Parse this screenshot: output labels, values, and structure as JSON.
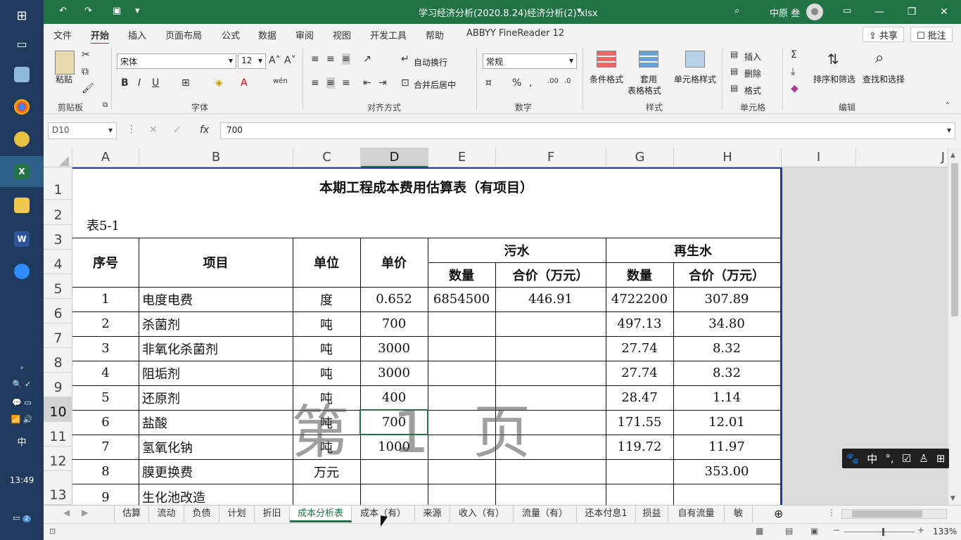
{
  "window": {
    "title": "学习经济分析(2020.8.24)经济分析(2).xlsx",
    "user": "中原 叁"
  },
  "menu": {
    "items": [
      "文件",
      "开始",
      "插入",
      "页面布局",
      "公式",
      "数据",
      "审阅",
      "视图",
      "开发工具",
      "帮助",
      "ABBYY FineReader 12"
    ],
    "share": "共享",
    "comment": "批注"
  },
  "ribbon": {
    "clipboard": {
      "paste": "粘贴",
      "label": "剪贴板"
    },
    "font": {
      "name": "宋体",
      "size": "12",
      "label": "字体",
      "bold": "B",
      "italic": "I",
      "underline": "U"
    },
    "alignment": {
      "wrap": "自动换行",
      "merge": "合并后居中",
      "label": "对齐方式"
    },
    "number": {
      "format": "常规",
      "label": "数字"
    },
    "styles": {
      "cond": "条件格式",
      "table1": "套用",
      "table2": "表格格式",
      "cell": "单元格样式",
      "label": "样式"
    },
    "cells": {
      "insert": "插入",
      "delete": "删除",
      "format": "格式",
      "label": "单元格"
    },
    "edit": {
      "sort": "排序和筛选",
      "find": "查找和选择",
      "label": "编辑"
    }
  },
  "formula_bar": {
    "namebox": "D10",
    "value": "700"
  },
  "columns": [
    "A",
    "B",
    "C",
    "D",
    "E",
    "F",
    "G",
    "H",
    "I",
    "J"
  ],
  "rows": [
    "1",
    "2",
    "3",
    "4",
    "5",
    "6",
    "7",
    "8",
    "9",
    "10",
    "11",
    "12",
    "13"
  ],
  "sheet": {
    "title": "本期工程成本费用估算表（有项目）",
    "table_no": "表5-1",
    "headers": {
      "seq": "序号",
      "item": "项目",
      "unit": "单位",
      "price": "单价",
      "sewage": "污水",
      "reclaimed": "再生水",
      "qty1": "数量",
      "total1": "合价（万元）",
      "qty2": "数量",
      "total2": "合价（万元）"
    },
    "data": [
      {
        "seq": "1",
        "item": "电度电费",
        "unit": "度",
        "price": "0.652",
        "q1": "6854500",
        "t1": "446.91",
        "q2": "4722200",
        "t2": "307.89"
      },
      {
        "seq": "2",
        "item": "杀菌剂",
        "unit": "吨",
        "price": "700",
        "q1": "",
        "t1": "",
        "q2": "497.13",
        "t2": "34.80"
      },
      {
        "seq": "3",
        "item": "非氧化杀菌剂",
        "unit": "吨",
        "price": "3000",
        "q1": "",
        "t1": "",
        "q2": "27.74",
        "t2": "8.32"
      },
      {
        "seq": "4",
        "item": "阻垢剂",
        "unit": "吨",
        "price": "3000",
        "q1": "",
        "t1": "",
        "q2": "27.74",
        "t2": "8.32"
      },
      {
        "seq": "5",
        "item": "还原剂",
        "unit": "吨",
        "price": "400",
        "q1": "",
        "t1": "",
        "q2": "28.47",
        "t2": "1.14"
      },
      {
        "seq": "6",
        "item": "盐酸",
        "unit": "吨",
        "price": "700",
        "q1": "",
        "t1": "",
        "q2": "171.55",
        "t2": "12.01"
      },
      {
        "seq": "7",
        "item": "氢氧化钠",
        "unit": "吨",
        "price": "1000",
        "q1": "",
        "t1": "",
        "q2": "119.72",
        "t2": "11.97"
      },
      {
        "seq": "8",
        "item": "膜更换费",
        "unit": "万元",
        "price": "",
        "q1": "",
        "t1": "",
        "q2": "",
        "t2": "353.00"
      },
      {
        "seq": "9",
        "item": "生化池改造",
        "unit": "",
        "price": "",
        "q1": "",
        "t1": "",
        "q2": "",
        "t2": ""
      }
    ],
    "watermark": "第 1 页"
  },
  "tabs": [
    "估算",
    "流动",
    "负债",
    "计划",
    "折旧",
    "成本分析表",
    "成本（有）",
    "来源",
    "收入（有）",
    "流量（有）",
    "还本付息1",
    "损益",
    "自有流量",
    "敏"
  ],
  "active_tab": "成本分析表",
  "status": {
    "zoom": "133%"
  },
  "taskbar": {
    "time": "13:49",
    "ime": "中",
    "badge": "2"
  },
  "ime_bar": [
    "中",
    "°,",
    "☑",
    "♙",
    "⊞"
  ]
}
